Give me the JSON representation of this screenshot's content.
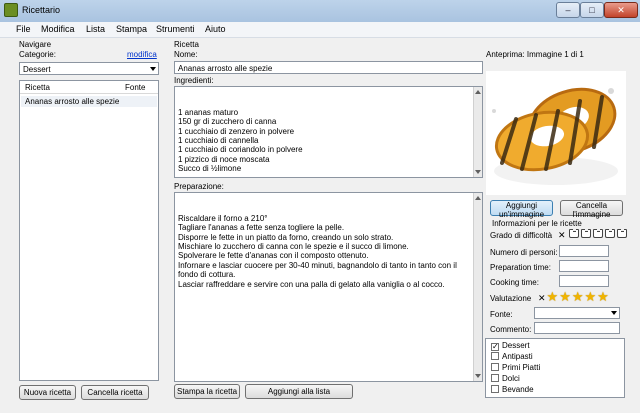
{
  "window": {
    "title": "Ricettario",
    "min": "–",
    "max": "□",
    "close": "✕"
  },
  "menu": [
    "File",
    "Modifica",
    "Lista",
    "Stampa",
    "Strumenti",
    "Aiuto"
  ],
  "nav": {
    "group": "Navigare",
    "categories_label": "Categorie:",
    "edit_link": "modifica",
    "category_value": "Dessert",
    "col_recipe": "Ricetta",
    "col_source": "Fonte",
    "recipes": [
      "Ananas arrosto alle spezie"
    ],
    "new_button": "Nuova ricetta",
    "delete_button": "Cancella ricetta"
  },
  "recipe": {
    "group": "Ricetta",
    "name_label": "Nome:",
    "name_value": "Ananas arrosto alle spezie",
    "ingredients_label": "Ingredienti:",
    "ingredients": "1 ananas maturo\n150 gr di zucchero di canna\n1 cucchiaio di zenzero in polvere\n1 cucchiaio di cannella\n1 cucchiaio di coriandolo in polvere\n1 pizzico di noce moscata\nSucco di ½limone",
    "preparation_label": "Preparazione:",
    "preparation": "Riscaldare il forno a 210°\nTagliare l'ananas a fette senza togliere la pelle.\nDisporre le fette in un piatto da forno, creando un solo strato.\nMischiare lo zucchero di canna con le spezie e il succo di limone.\nSpolverare le fette d'ananas con il composto ottenuto.\nInfornare e lasciar cuocere per 30-40 minuti, bagnandolo di tanto in tanto con il fondo di cottura.\nLasciar raffreddare e servire con una palla di gelato alla vaniglia o al cocco.",
    "print_button": "Stampa la ricetta",
    "add_list_button": "Aggiungi alla lista"
  },
  "side": {
    "preview_label": "Anteprima: Immagine 1 di 1",
    "add_image": "Aggiungi un'immagine",
    "delete_image": "Cancella l'immagine",
    "info_title": "Informazioni per le ricette",
    "difficulty_label": "Grado di difficoltà",
    "difficulty_level": 0,
    "difficulty_max": 5,
    "persons_label": "Numero di personi:",
    "prep_label": "Preparation time:",
    "cook_label": "Cooking time:",
    "rating_label": "Valutazione",
    "rating_stars": 5,
    "source_label": "Fonte:",
    "comment_label": "Commento:",
    "categories": [
      {
        "name": "Dessert",
        "checked": true
      },
      {
        "name": "Antipasti",
        "checked": false
      },
      {
        "name": "Primi Piatti",
        "checked": false
      },
      {
        "name": "Dolci",
        "checked": false
      },
      {
        "name": "Bevande",
        "checked": false
      }
    ]
  },
  "icons": {
    "app": "cookbook-icon",
    "shirt": "difficulty-shirt-icon",
    "star": "star-icon",
    "clear": "x-icon"
  }
}
